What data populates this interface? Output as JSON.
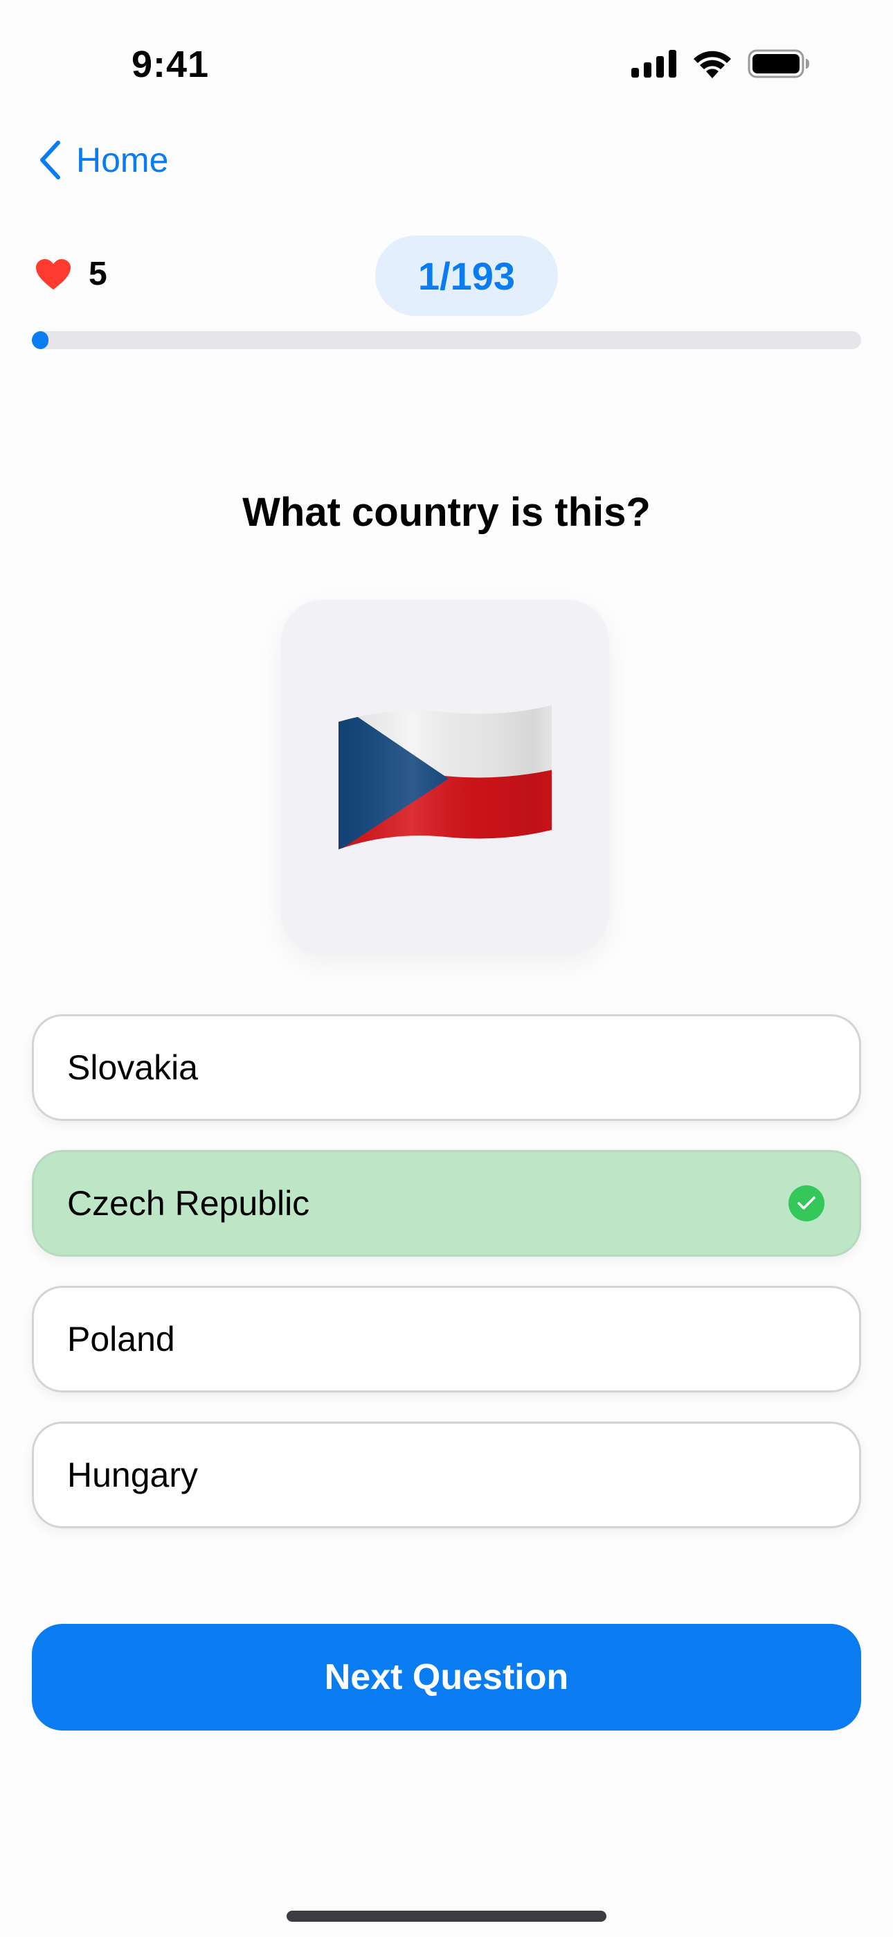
{
  "status_bar": {
    "time": "9:41",
    "icons": [
      "cellular-signal-icon",
      "wifi-icon",
      "battery-icon"
    ]
  },
  "nav": {
    "back_label": "Home",
    "back_icon": "chevron-left-icon"
  },
  "quiz": {
    "lives_icon": "heart-icon",
    "lives": "5",
    "progress_label": "1/193",
    "progress_fraction": 0.0052,
    "question": "What country is this?",
    "flag": {
      "icon": "czech-flag-icon",
      "colors": [
        "#ffffff",
        "#d7141a",
        "#11457e"
      ]
    },
    "options": [
      {
        "label": "Slovakia",
        "state": "default"
      },
      {
        "label": "Czech Republic",
        "state": "correct"
      },
      {
        "label": "Poland",
        "state": "default"
      },
      {
        "label": "Hungary",
        "state": "default"
      }
    ],
    "next_label": "Next Question"
  },
  "colors": {
    "accent": "#0a7cf2",
    "correct_bg": "#bde6c7",
    "correct_check": "#34c759",
    "heart": "#ff3b30"
  }
}
